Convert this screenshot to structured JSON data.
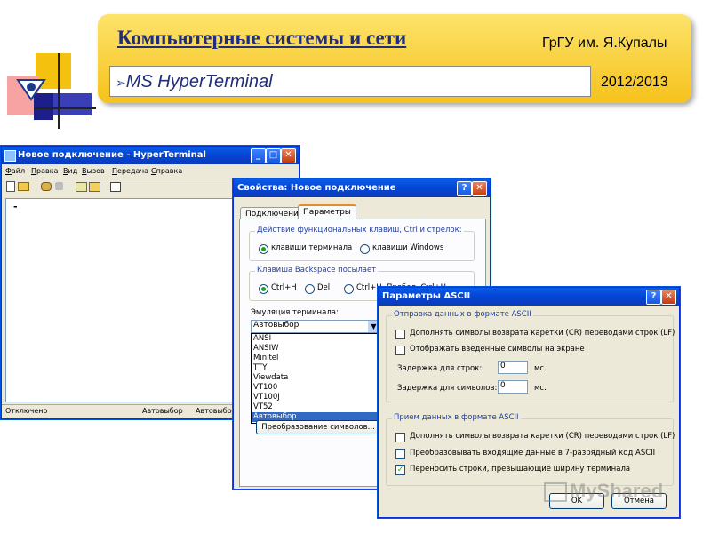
{
  "slide": {
    "title": "Компьютерные системы и сети",
    "university": "ГрГУ им. Я.Купалы",
    "subtitle": "MS HyperTerminal",
    "year": "2012/2013",
    "bullet_icon": "arrow-bullet"
  },
  "colors": {
    "header_yellow": "#f6c21d",
    "title_blue": "#1f2d7a",
    "xp_title_blue": "#0546d6",
    "selection_blue": "#316ac5"
  },
  "hyperterminal": {
    "title": "Новое подключение - HyperTerminal",
    "menu": [
      "Файл",
      "Правка",
      "Вид",
      "Вызов",
      "Передача",
      "Справка"
    ],
    "toolbar_icons": [
      "new-icon",
      "open-icon",
      "phone-icon",
      "disconnect-icon",
      "send-icon",
      "receive-icon",
      "properties-icon"
    ],
    "cursor": "-",
    "status": [
      "Отключено",
      "Автовыбор",
      "Автовыбо"
    ]
  },
  "properties_dialog": {
    "title": "Свойства: Новое подключение",
    "tabs": [
      "Подключение",
      "Параметры"
    ],
    "function_keys_group": "Действие функциональных клавиш, Ctrl и стрелок:",
    "function_keys_options": [
      "клавиши терминала",
      "клавиши Windows"
    ],
    "backspace_group": "Клавиша Backspace посылает",
    "backspace_options": [
      "Ctrl+H",
      "Del",
      "Ctrl+H, Пробел, Ctrl+H"
    ],
    "emulation_label": "Эмуляция терминала:",
    "emulation_selected": "Автовыбор",
    "emulation_options": [
      "ANSI",
      "ANSIW",
      "Minitel",
      "TTY",
      "Viewdata",
      "VT100",
      "VT100J",
      "VT52",
      "Автовыбор"
    ],
    "convert_button": "Преобразование символов..."
  },
  "ascii_dialog": {
    "title": "Параметры ASCII",
    "send_group": "Отправка данных в формате ASCII",
    "send_options": [
      {
        "label": "Дополнять символы возврата каретки (CR) переводами строк (LF)",
        "checked": false
      },
      {
        "label": "Отображать введенные символы на экране",
        "checked": false
      }
    ],
    "line_delay_label": "Задержка для строк:",
    "line_delay_value": "0",
    "char_delay_label": "Задержка для символов:",
    "char_delay_value": "0",
    "ms_unit": "мс.",
    "receive_group": "Прием данных в формате ASCII",
    "receive_options": [
      {
        "label": "Дополнять символы возврата каретки (CR) переводами строк (LF)",
        "checked": false
      },
      {
        "label": "Преобразовывать входящие данные в 7-разрядный код ASCII",
        "checked": false
      },
      {
        "label": "Переносить строки, превышающие ширину терминала",
        "checked": true
      }
    ],
    "ok_button": "OK",
    "cancel_button": "Отмена"
  },
  "watermark": "MyShared"
}
